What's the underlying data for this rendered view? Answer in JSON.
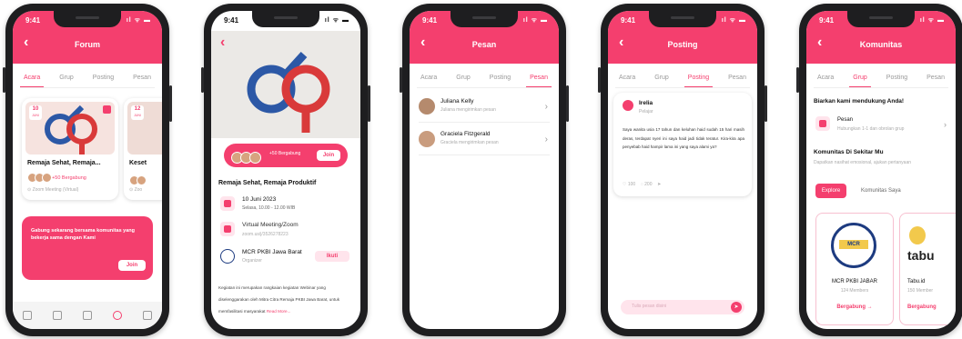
{
  "status": {
    "time": "9:41",
    "icons": "ıl ᯤ ▬"
  },
  "tabs": [
    "Acara",
    "Grup",
    "Posting",
    "Pesan"
  ],
  "phone1": {
    "title": "Forum",
    "event_card": {
      "date_day": "10",
      "date_month": "JUNI",
      "title": "Remaja Sehat, Remaja...",
      "joined": "+50 Bergabung",
      "location": "Zoom Meeting (Virtual)"
    },
    "event_card2": {
      "date_day": "12",
      "date_month": "JUNI",
      "title": "Keset",
      "location": "Zoo"
    },
    "promo": {
      "text": "Gabung sekarang bersama komunitas yang bekerja sama dengan Kami",
      "button": "Join"
    }
  },
  "phone2": {
    "joined": "+50 Bergabung",
    "join_button": "Join",
    "title": "Remaja Sehat, Remaja Produktif",
    "date": "10 Juni 2023",
    "time": "Selasa, 10.00 - 12.00 WIB",
    "venue": "Virtual Meeting/Zoom",
    "venue_link": "zoom.us/j/3526278223",
    "org_name": "MCR PKBI Jawa Barat",
    "org_role": "Organizer",
    "org_button": "Ikuti",
    "desc": "Kegiatan ini merupakan rangkaian kegiatan Webinar yang diselenggarakan oleh Mitra Citra Remaja PKBI Jawa Barat, untuk memfasilitasi masyarakat",
    "read_more": "Read More..."
  },
  "phone3": {
    "title": "Pesan",
    "messages": [
      {
        "name": "Juliana Kelly",
        "preview": "Juliana mengirimkan pesan"
      },
      {
        "name": "Graciela Fitzgerald",
        "preview": "Graciela mengirimkan pesan"
      }
    ]
  },
  "phone4": {
    "title": "Posting",
    "post": {
      "author": "Irelia",
      "role": "Pelajar",
      "body": "Saya wanita usia 17 tahun dan keluhan haid sudah 15 hari masih deras, terdapat nyeri ini saya haid jadi tidak teratur. Kira-kira apa penyebab haid hampir lama ini yang saya alami ya?",
      "likes": "100",
      "comments": "200"
    },
    "input_placeholder": "Tulis pesan disini"
  },
  "phone5": {
    "title": "Komunitas",
    "heading": "Biarkan kami mendukung Anda!",
    "pesan_title": "Pesan",
    "pesan_desc": "Hubungkan 1-1 dan obrolan grup",
    "nearby_title": "Komunitas Di Sekitar Mu",
    "nearby_desc": "Dapatkan nasihat emosional, ajukan pertanyaan",
    "explore_button": "Explore",
    "my_communities": "Komunitas Saya",
    "communities": [
      {
        "logo_text": "MCR",
        "name": "MCR PKBI JABAR",
        "members": "124 Members",
        "action": "Bergabung →"
      },
      {
        "logo_text": "tabu",
        "name": "Tabu.id",
        "members": "150 Member",
        "action": "Bergabung"
      }
    ]
  },
  "colors": {
    "primary": "#f43f6e"
  }
}
